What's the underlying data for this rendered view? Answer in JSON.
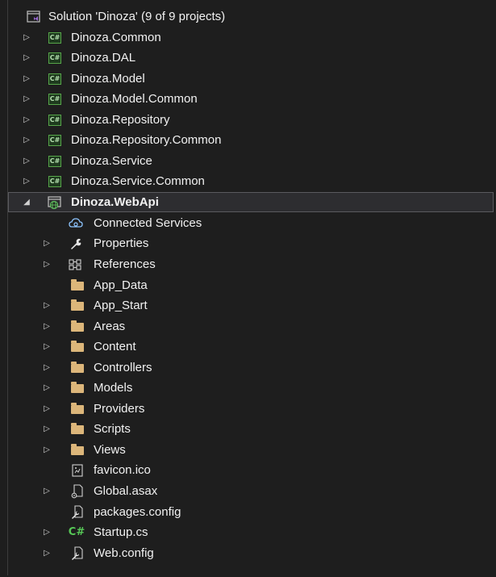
{
  "solution": {
    "label": "Solution 'Dinoza' (9 of 9 projects)",
    "icon": "solution-icon"
  },
  "projects": [
    {
      "label": "Dinoza.Common",
      "icon": "csharp-project-icon",
      "badge": "C#"
    },
    {
      "label": "Dinoza.DAL",
      "icon": "csharp-project-icon",
      "badge": "C#"
    },
    {
      "label": "Dinoza.Model",
      "icon": "csharp-project-icon",
      "badge": "C#"
    },
    {
      "label": "Dinoza.Model.Common",
      "icon": "csharp-project-icon",
      "badge": "C#"
    },
    {
      "label": "Dinoza.Repository",
      "icon": "csharp-project-icon",
      "badge": "C#"
    },
    {
      "label": "Dinoza.Repository.Common",
      "icon": "csharp-project-icon",
      "badge": "C#"
    },
    {
      "label": "Dinoza.Service",
      "icon": "csharp-project-icon",
      "badge": "C#"
    },
    {
      "label": "Dinoza.Service.Common",
      "icon": "csharp-project-icon",
      "badge": "C#"
    }
  ],
  "webapi": {
    "label": "Dinoza.WebApi",
    "icon": "web-project-icon",
    "children": [
      {
        "label": "Connected Services",
        "icon": "connected-services-icon"
      },
      {
        "label": "Properties",
        "icon": "wrench-icon"
      },
      {
        "label": "References",
        "icon": "references-icon"
      },
      {
        "label": "App_Data",
        "icon": "folder-icon"
      },
      {
        "label": "App_Start",
        "icon": "folder-icon"
      },
      {
        "label": "Areas",
        "icon": "folder-icon"
      },
      {
        "label": "Content",
        "icon": "folder-icon"
      },
      {
        "label": "Controllers",
        "icon": "folder-icon"
      },
      {
        "label": "Models",
        "icon": "folder-icon"
      },
      {
        "label": "Providers",
        "icon": "folder-icon"
      },
      {
        "label": "Scripts",
        "icon": "folder-icon"
      },
      {
        "label": "Views",
        "icon": "folder-icon"
      },
      {
        "label": "favicon.ico",
        "icon": "image-file-icon"
      },
      {
        "label": "Global.asax",
        "icon": "asax-file-icon"
      },
      {
        "label": "packages.config",
        "icon": "config-file-icon"
      },
      {
        "label": "Startup.cs",
        "icon": "csharp-file-icon",
        "badge": "C#"
      },
      {
        "label": "Web.config",
        "icon": "config-file-icon"
      }
    ]
  },
  "colors": {
    "background": "#1e1e1e",
    "text": "#f1f1f1",
    "folder": "#dcb67a",
    "csharp": "#57a64a",
    "selection": "#2d2d30"
  }
}
